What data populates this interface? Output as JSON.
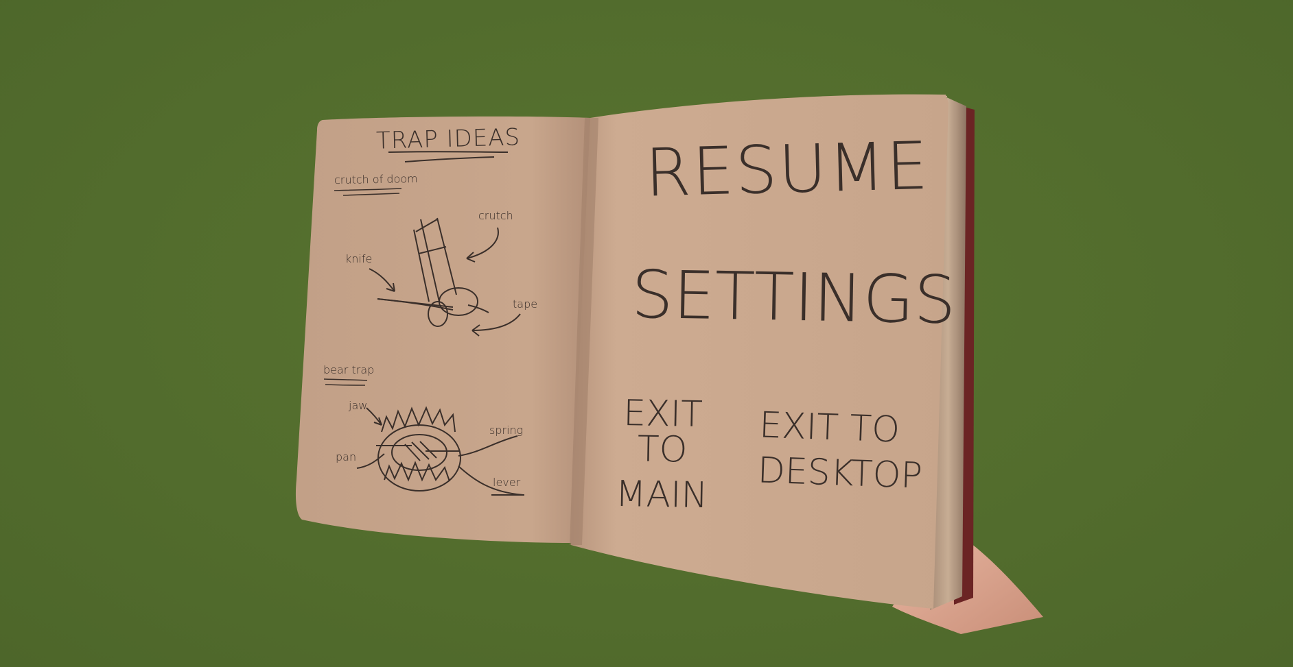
{
  "left_page": {
    "title": "TRAP IDEAS",
    "section1": {
      "heading": "crutch of doom",
      "labels": [
        "crutch",
        "knife",
        "tape"
      ]
    },
    "section2": {
      "heading": "bear trap",
      "labels": [
        "jaw",
        "spring",
        "pan",
        "lever"
      ]
    }
  },
  "menu": {
    "resume": "RESUME",
    "settings": "SETTINGS",
    "exit_main_line1": "EXIT TO",
    "exit_main_line2": "MAIN",
    "exit_desktop_line1": "EXIT TO",
    "exit_desktop_line2": "DESKTOP"
  },
  "colors": {
    "background": "#546f2f",
    "page": "#c9a88d",
    "ink": "#3a2f2a"
  }
}
